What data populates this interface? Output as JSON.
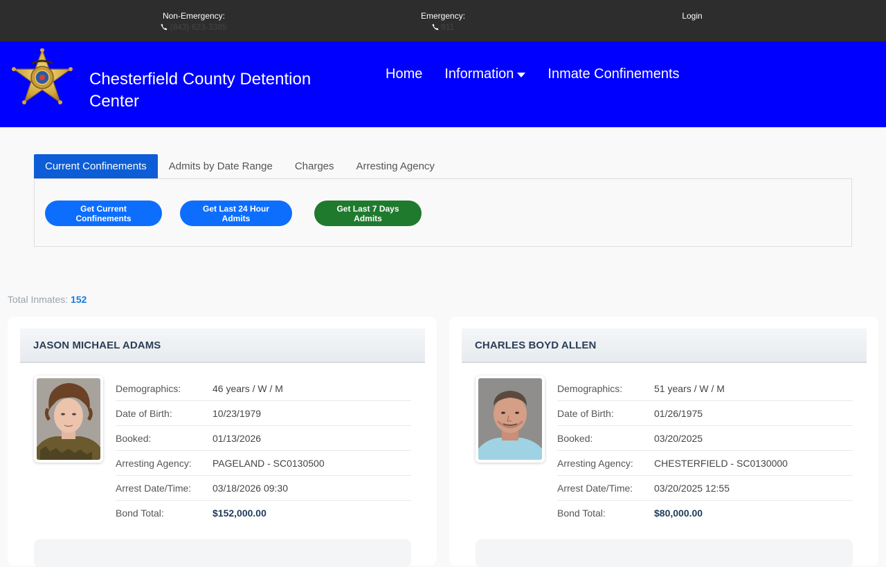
{
  "topbar": {
    "non_emergency_label": "Non-Emergency:",
    "non_emergency_number": "(843) 623-3385",
    "emergency_label": "Emergency:",
    "emergency_number": "911",
    "login": "Login"
  },
  "header": {
    "title": "Chesterfield County Detention Center",
    "nav": [
      "Home",
      "Information",
      "Inmate Confinements"
    ],
    "brand_color": "#0000ff"
  },
  "tabs": [
    "Current Confinements",
    "Admits by Date Range",
    "Charges",
    "Arresting Agency"
  ],
  "buttons": {
    "current": "Get Current Confinements",
    "last24": "Get Last 24 Hour Admits",
    "last7": "Get Last 7 Days Admits"
  },
  "total": {
    "label": "Total Inmates:",
    "value": "152"
  },
  "field_labels": {
    "demographics": "Demographics:",
    "dob": "Date of Birth:",
    "booked": "Booked:",
    "agency": "Arresting Agency:",
    "arrest": "Arrest Date/Time:",
    "bond": "Bond Total:"
  },
  "inmates": [
    {
      "name": "JASON MICHAEL ADAMS",
      "demographics": "46 years / W / M",
      "dob": "10/23/1979",
      "booked": "01/13/2026",
      "agency": "PAGELAND - SC0130500",
      "arrest": "03/18/2026 09:30",
      "bond": "$152,000.00"
    },
    {
      "name": "CHARLES BOYD ALLEN",
      "demographics": "51 years / W / M",
      "dob": "01/26/1975",
      "booked": "03/20/2025",
      "agency": "CHESTERFIELD - SC0130000",
      "arrest": "03/20/2025 12:55",
      "bond": "$80,000.00"
    }
  ]
}
